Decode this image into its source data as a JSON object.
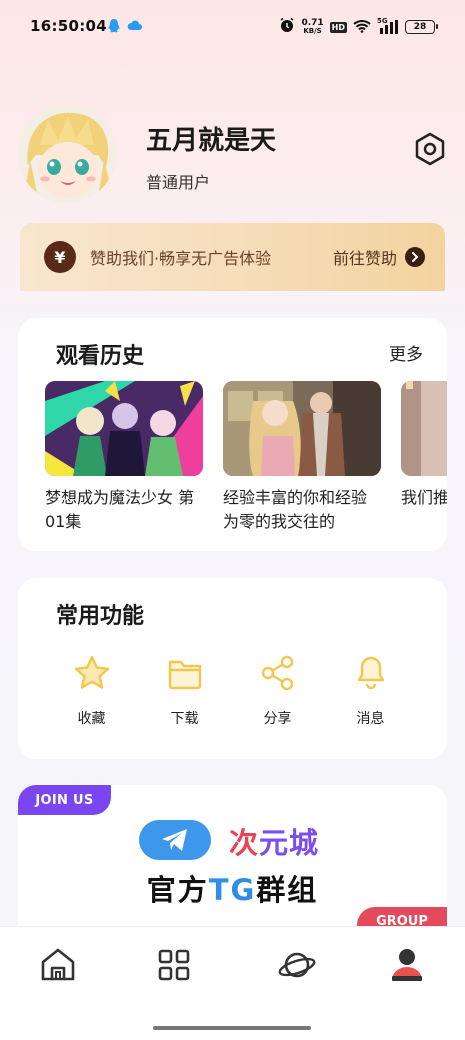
{
  "status_bar": {
    "time": "16:50:04",
    "net_speed_value": "0.71",
    "net_speed_unit": "KB/S",
    "hd_label": "HD",
    "signal_label": "5G",
    "battery": "28"
  },
  "profile": {
    "username": "五月就是天",
    "role": "普通用户"
  },
  "sponsor": {
    "icon_text": "¥",
    "text": "赞助我们·畅享无广告体验",
    "action": "前往赞助"
  },
  "history": {
    "title": "观看历史",
    "more": "更多",
    "items": [
      {
        "title": "梦想成为魔法少女 第01集"
      },
      {
        "title": "经验丰富的你和经验为零的我交往的"
      },
      {
        "title": "我们推荐"
      }
    ]
  },
  "functions": {
    "title": "常用功能",
    "items": [
      {
        "label": "收藏",
        "icon": "star-icon"
      },
      {
        "label": "下载",
        "icon": "folder-icon"
      },
      {
        "label": "分享",
        "icon": "share-icon"
      },
      {
        "label": "消息",
        "icon": "bell-icon"
      }
    ]
  },
  "tg_banner": {
    "join_label": "JOIN US",
    "brand_part1": "次",
    "brand_part2": "元城",
    "group_prefix": "官方",
    "group_tg": "TG",
    "group_suffix": "群组",
    "group_badge": "GROUP"
  },
  "bottom_nav": [
    "home-icon",
    "grid-icon",
    "planet-icon",
    "profile-icon"
  ],
  "colors": {
    "accent_yellow": "#f3c74e",
    "join_purple": "#7a46f0",
    "group_red": "#e34a5d",
    "telegram_blue": "#3d97ea"
  }
}
